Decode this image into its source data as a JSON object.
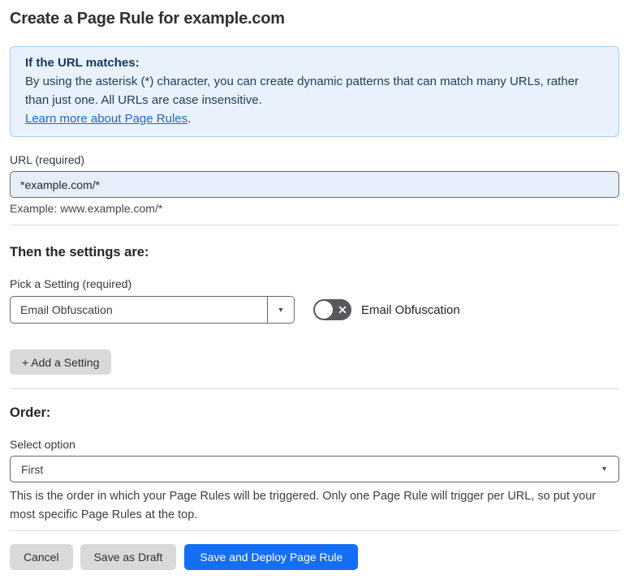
{
  "page": {
    "title": "Create a Page Rule for example.com"
  },
  "info_box": {
    "heading": "If the URL matches:",
    "body": "By using the asterisk (*) character, you can create dynamic patterns that can match many URLs, rather than just one. All URLs are case insensitive.",
    "link_label": "Learn more about Page Rules",
    "link_suffix": "."
  },
  "url_field": {
    "label": "URL (required)",
    "value": "*example.com/*",
    "helper": "Example: www.example.com/*"
  },
  "settings_section": {
    "heading": "Then the settings are:",
    "picker_label": "Pick a Setting (required)",
    "picker_value": "Email Obfuscation",
    "toggle": {
      "state": "off",
      "label": "Email Obfuscation"
    },
    "add_button_label": "+ Add a Setting"
  },
  "order_section": {
    "heading": "Order:",
    "select_label": "Select option",
    "select_value": "First",
    "helper": "This is the order in which your Page Rules will be triggered. Only one Page Rule will trigger per URL, so put your most specific Page Rules at the top."
  },
  "footer": {
    "cancel_label": "Cancel",
    "save_draft_label": "Save as Draft",
    "save_deploy_label": "Save and Deploy Page Rule"
  },
  "icons": {
    "setting_caret": "caret-down-icon",
    "order_caret": "caret-down-icon",
    "toggle_x": "x-icon"
  },
  "colors": {
    "info_bg": "#e9f2fc",
    "info_border": "#a9cdee",
    "info_text": "#1d3d63",
    "link": "#2268c3",
    "input_bg": "#e7eefb",
    "input_border": "#696b6f",
    "gray_button_bg": "#d9d9d9",
    "primary_button_bg": "#156ff5",
    "toggle_off_bg": "#56585c",
    "divider": "#dcdee0"
  }
}
